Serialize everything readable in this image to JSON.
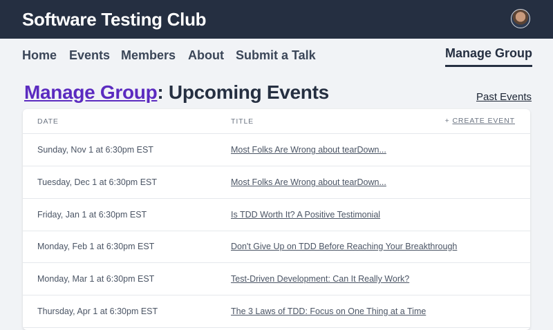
{
  "header": {
    "brand": "Software Testing Club",
    "avatar_icon": "user-avatar"
  },
  "nav": {
    "items": [
      "Home",
      "Events",
      "Members",
      "About",
      "Submit a Talk"
    ],
    "right_item": "Manage Group",
    "active": "Manage Group"
  },
  "page": {
    "breadcrumb_link": "Manage Group",
    "title_suffix": ": Upcoming Events",
    "past_events_link": "Past Events"
  },
  "table": {
    "columns": [
      "Date",
      "Title"
    ],
    "create_action_prefix": "+",
    "create_action": "Create Event",
    "rows": [
      {
        "date": "Sunday, Nov 1 at 6:30pm EST",
        "title": "Most Folks Are Wrong about tearDown..."
      },
      {
        "date": "Tuesday, Dec 1 at 6:30pm EST",
        "title": "Most Folks Are Wrong about tearDown..."
      },
      {
        "date": "Friday, Jan 1 at 6:30pm EST",
        "title": "Is TDD Worth It? A Positive Testimonial"
      },
      {
        "date": "Monday, Feb 1 at 6:30pm EST",
        "title": "Don't Give Up on TDD Before Reaching Your Breakthrough"
      },
      {
        "date": "Monday, Mar 1 at 6:30pm EST",
        "title": "Test-Driven Development: Can It Really Work?"
      },
      {
        "date": "Thursday, Apr 1 at 6:30pm EST",
        "title": "The 3 Laws of TDD: Focus on One Thing at a Time"
      }
    ]
  },
  "colors": {
    "header_bg": "#252f41",
    "page_bg": "#f1f3f6",
    "link_accent": "#5b2bc0"
  }
}
